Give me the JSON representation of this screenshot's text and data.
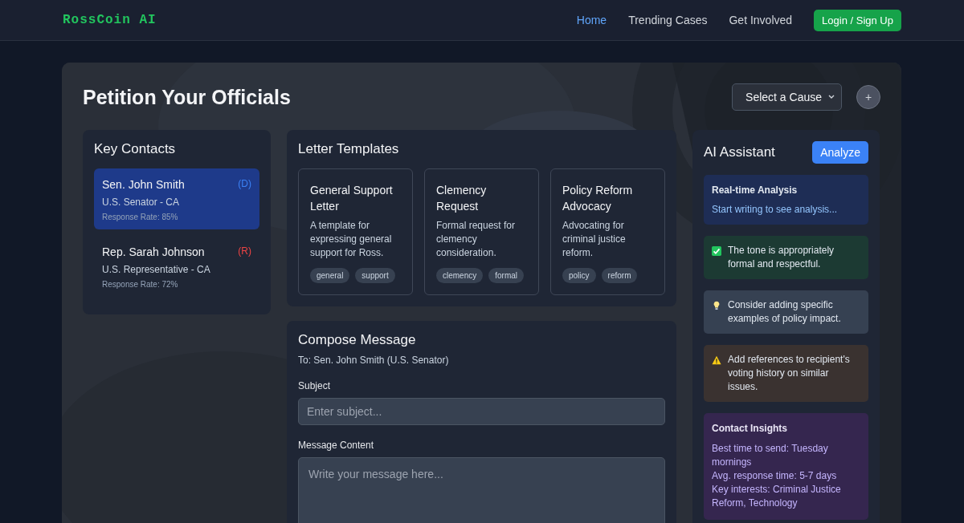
{
  "brand": "RossCoin AI",
  "nav": [
    {
      "label": "Home",
      "selected": true
    },
    {
      "label": "Trending Cases",
      "selected": false
    },
    {
      "label": "Get Involved",
      "selected": false
    }
  ],
  "login_button": "Login / Sign Up",
  "page_title": "Petition Your Officials",
  "cause_select": "Select a Cause",
  "add_button": "+",
  "contacts": {
    "title": "Key Contacts",
    "items": [
      {
        "name": "Sen. John Smith",
        "party": "(D)",
        "color": "#3b82f6",
        "role": "U.S. Senator - CA",
        "rate": "Response Rate: 85%",
        "selected": true
      },
      {
        "name": "Rep. Sarah Johnson",
        "party": "(R)",
        "color": "#ef4444",
        "role": "U.S. Representative - CA",
        "rate": "Response Rate: 72%",
        "selected": false
      }
    ]
  },
  "templates": {
    "title": "Letter Templates",
    "items": [
      {
        "title": "General Support Letter",
        "description": "A template for expressing general support for Ross.",
        "tags": [
          "general",
          "support"
        ]
      },
      {
        "title": "Clemency Request",
        "description": "Formal request for clemency consideration.",
        "tags": [
          "clemency",
          "formal"
        ]
      },
      {
        "title": "Policy Reform Advocacy",
        "description": "Advocating for criminal justice reform.",
        "tags": [
          "policy",
          "reform"
        ]
      }
    ]
  },
  "compose": {
    "title": "Compose Message",
    "to": "To: Sen. John Smith (U.S. Senator)",
    "subject_label": "Subject",
    "subject_placeholder": "Enter subject...",
    "content_label": "Message Content",
    "content_placeholder": "Write your message here..."
  },
  "assistant": {
    "title": "AI Assistant",
    "analyze_button": "Analyze",
    "realtime": {
      "title": "Real-time Analysis",
      "text": "Start writing to see analysis..."
    },
    "feedback": [
      {
        "kind": "success",
        "text": "The tone is appropriately formal and respectful."
      },
      {
        "kind": "tip",
        "text": "Consider adding specific examples of policy impact."
      },
      {
        "kind": "warning",
        "text": "Add references to recipient's voting history on similar issues."
      }
    ],
    "insights": {
      "title": "Contact Insights",
      "lines": [
        "Best time to send: Tuesday mornings",
        "Avg. response time: 5-7 days",
        "Key interests: Criminal Justice Reform, Technology"
      ]
    }
  }
}
